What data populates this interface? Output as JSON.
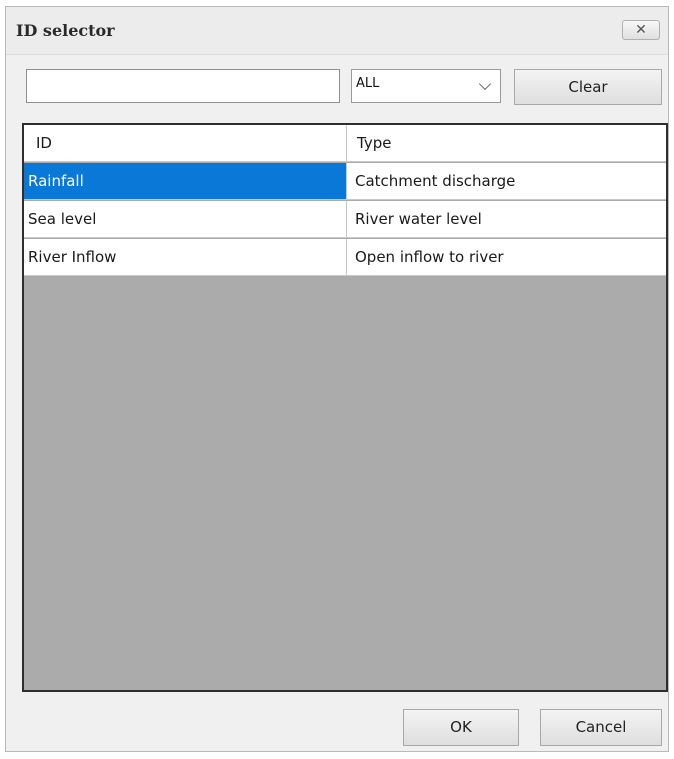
{
  "window": {
    "title": "ID selector",
    "close_symbol": "✕"
  },
  "filter": {
    "value": "",
    "placeholder": ""
  },
  "type_select": {
    "selected": "ALL"
  },
  "buttons": {
    "clear": "Clear",
    "ok": "OK",
    "cancel": "Cancel"
  },
  "table": {
    "columns": [
      "ID",
      "Type"
    ],
    "rows": [
      {
        "id": "Rainfall",
        "type": "Catchment discharge",
        "selected": true
      },
      {
        "id": "Sea level",
        "type": "River water level",
        "selected": false
      },
      {
        "id": "River Inflow",
        "type": "Open inflow to river",
        "selected": false
      }
    ]
  },
  "colors": {
    "selection": "#0a78d7",
    "grid_empty": "#ababab",
    "window_bg": "#f0f0f0"
  },
  "icons": {
    "close": "close-icon",
    "dropdown": "chevron-down-icon"
  }
}
